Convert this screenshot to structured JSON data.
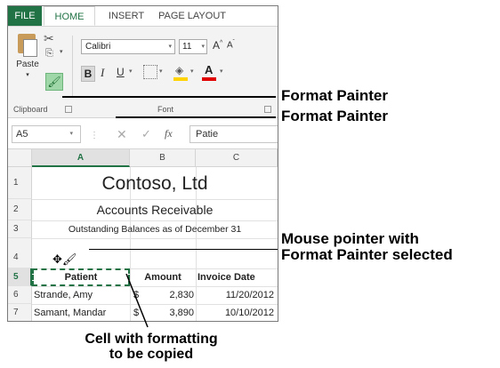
{
  "ribbon": {
    "tabs": [
      "FILE",
      "HOME",
      "INSERT",
      "PAGE LAYOUT"
    ],
    "active_tab": "HOME",
    "clipboard": {
      "paste_label": "Paste",
      "group_label": "Clipboard"
    },
    "font": {
      "group_label": "Font",
      "font_name": "Calibri",
      "font_size": "11"
    }
  },
  "formula_bar": {
    "name_box": "A5",
    "fx": "fx",
    "content": "Patie"
  },
  "sheet": {
    "columns": [
      "A",
      "B",
      "C"
    ],
    "rows": [
      "1",
      "2",
      "3",
      "4",
      "5",
      "6",
      "7"
    ],
    "title": "Contoso, Ltd",
    "subtitle": "Accounts Receivable",
    "caption": "Outstanding Balances as of December 31",
    "headers": [
      "Patient",
      "Amount",
      "Invoice Date"
    ],
    "data": [
      {
        "patient": "Strande, Amy",
        "currency": "$",
        "amount": "2,830",
        "date": "11/20/2012"
      },
      {
        "patient": "Samant, Mandar",
        "currency": "$",
        "amount": "3,890",
        "date": "10/10/2012"
      }
    ]
  },
  "callouts": {
    "format_painter_1": "Format Painter",
    "format_painter_2": "Format Painter",
    "pointer_line1": "Mouse pointer with",
    "pointer_line2": "Format Painter selected",
    "cell_line1": "Cell with formatting",
    "cell_line2": "to be copied"
  },
  "colors": {
    "excel_green": "#217346",
    "fill_yellow": "#ffd300",
    "font_red": "#e10000"
  }
}
